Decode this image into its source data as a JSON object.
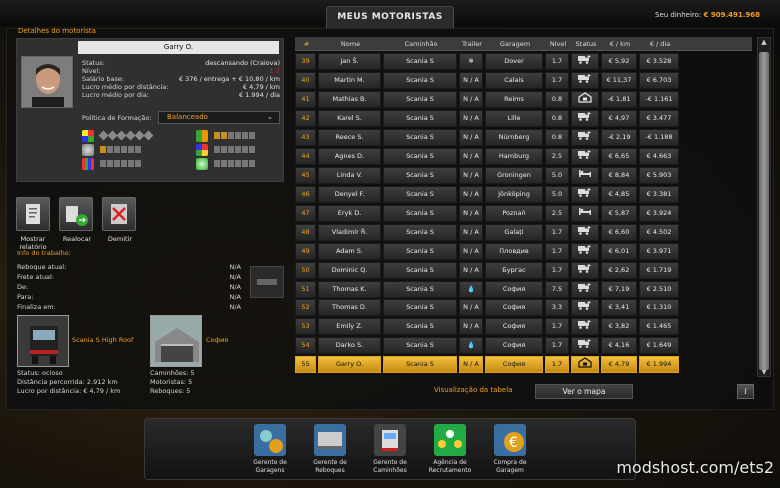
{
  "header": {
    "title": "MEUS MOTORISTAS",
    "money_label": "Seu dinheiro:",
    "money_value": "€ 909.491.968"
  },
  "details": {
    "title": "Detalhes do motorista",
    "name": "Garry O.",
    "stats": [
      {
        "label": "Status:",
        "value": "descansando (Craiova)",
        "red": false
      },
      {
        "label": "Nível:",
        "value": "1.7",
        "red": true
      },
      {
        "label": "Salário base:",
        "value": "€ 376 / entrega + € 10,80 / km",
        "red": false
      },
      {
        "label": "Lucro médio por distância:",
        "value": "€ 4,79 / km",
        "red": false
      },
      {
        "label": "Lucro médio por dia:",
        "value": "€ 1.994 / dia",
        "red": false
      }
    ],
    "policy_label": "Política de Formação:",
    "policy_value": "Balanceado",
    "skills_left": [
      {
        "icon": "adr-icon",
        "diamonds": 6,
        "squares": 0
      },
      {
        "icon": "distance-icon",
        "diamonds": 0,
        "squares": 6,
        "on": 0
      },
      {
        "icon": "valuable-cargo-icon",
        "diamonds": 0,
        "squares": 6,
        "on": 0
      }
    ],
    "skills_right": [
      {
        "icon": "high-value-icon",
        "squares": 6,
        "on": 0
      },
      {
        "icon": "fragile-icon",
        "squares": 6,
        "on": 0
      },
      {
        "icon": "eco-driving-icon",
        "squares": 6,
        "on": 0
      }
    ],
    "actions": [
      {
        "name": "show-report-button",
        "icon": "report-icon",
        "label": "Mostrar relatório"
      },
      {
        "name": "relocate-button",
        "icon": "relocate-icon",
        "label": "Realocar"
      },
      {
        "name": "fire-button",
        "icon": "fire-driver-icon",
        "label": "Demitir"
      }
    ]
  },
  "job": {
    "title": "Info do trabalho:",
    "rows": [
      {
        "label": "Reboque atual:",
        "value": "N/A"
      },
      {
        "label": "Frete atual:",
        "value": "N/A"
      },
      {
        "label": "De:",
        "value": "N/A"
      },
      {
        "label": "Para:",
        "value": "N/A"
      },
      {
        "label": "Finaliza em:",
        "value": "N/A"
      }
    ]
  },
  "truck": {
    "name": "Scania S High Roof",
    "status_label": "Status:",
    "status_value": "ocioso",
    "distance_label": "Distância percorrida:",
    "distance_value": "2.912 km",
    "profit_label": "Lucro por distância:",
    "profit_value": "€ 4,79 / km"
  },
  "garage": {
    "city": "София",
    "trucks_label": "Caminhões:",
    "trucks_value": "5",
    "drivers_label": "Motoristas:",
    "drivers_value": "5",
    "trailers_label": "Reboques:",
    "trailers_value": "5"
  },
  "table": {
    "headers": [
      "#",
      "Nome",
      "Caminhão",
      "Trailer",
      "Garagem",
      "Nível",
      "Status",
      "€ / km",
      "€ / dia"
    ],
    "rows": [
      {
        "n": "39",
        "name": "Jan Š.",
        "truck": "Scania S",
        "trailer": "❄",
        "garage": "Dover",
        "level": "1.7",
        "status": "driving",
        "km": "€ 5,92",
        "day": "€ 3.528"
      },
      {
        "n": "40",
        "name": "Martin M.",
        "truck": "Scania S",
        "trailer": "N / A",
        "garage": "Calais",
        "level": "1.7",
        "status": "driving",
        "km": "€ 11,37",
        "day": "€ 6.703"
      },
      {
        "n": "41",
        "name": "Mathias B.",
        "truck": "Scania S",
        "trailer": "N / A",
        "garage": "Reims",
        "level": "0.8",
        "status": "parked",
        "km": "-€ 1,81",
        "day": "-€ 1.161"
      },
      {
        "n": "42",
        "name": "Karel S.",
        "truck": "Scania S",
        "trailer": "N / A",
        "garage": "Lille",
        "level": "0.8",
        "status": "driving",
        "km": "€ 4,97",
        "day": "€ 3.477"
      },
      {
        "n": "43",
        "name": "Reece S.",
        "truck": "Scania S",
        "trailer": "N / A",
        "garage": "Nürnberg",
        "level": "0.8",
        "status": "driving",
        "km": "-€ 2,19",
        "day": "-€ 1.188"
      },
      {
        "n": "44",
        "name": "Agnes D.",
        "truck": "Scania S",
        "trailer": "N / A",
        "garage": "Hamburg",
        "level": "2.5",
        "status": "driving",
        "km": "€ 6,65",
        "day": "€ 4.663"
      },
      {
        "n": "45",
        "name": "Linda V.",
        "truck": "Scania S",
        "trailer": "N / A",
        "garage": "Groningen",
        "level": "5.0",
        "status": "resting",
        "km": "€ 8,84",
        "day": "€ 5.903"
      },
      {
        "n": "46",
        "name": "Denyel F.",
        "truck": "Scania S",
        "trailer": "N / A",
        "garage": "Jönköping",
        "level": "5.0",
        "status": "driving",
        "km": "€ 4,85",
        "day": "€ 3.381"
      },
      {
        "n": "47",
        "name": "Eryk D.",
        "truck": "Scania S",
        "trailer": "N / A",
        "garage": "Poznań",
        "level": "2.5",
        "status": "resting",
        "km": "€ 5,87",
        "day": "€ 3.924"
      },
      {
        "n": "48",
        "name": "Vladimír Ř.",
        "truck": "Scania S",
        "trailer": "N / A",
        "garage": "Galați",
        "level": "1.7",
        "status": "driving",
        "km": "€ 6,60",
        "day": "€ 4.502"
      },
      {
        "n": "49",
        "name": "Adam S.",
        "truck": "Scania S",
        "trailer": "N / A",
        "garage": "Пловдив",
        "level": "1.7",
        "status": "driving",
        "km": "€ 6,01",
        "day": "€ 3.971"
      },
      {
        "n": "50",
        "name": "Dominic Q.",
        "truck": "Scania S",
        "trailer": "N / A",
        "garage": "Бургас",
        "level": "1.7",
        "status": "driving",
        "km": "€ 2,62",
        "day": "€ 1.719"
      },
      {
        "n": "51",
        "name": "Thomas K.",
        "truck": "Scania S",
        "trailer": "💧",
        "garage": "София",
        "level": "7.5",
        "status": "driving",
        "km": "€ 7,19",
        "day": "€ 2.510"
      },
      {
        "n": "52",
        "name": "Thomas D.",
        "truck": "Scania S",
        "trailer": "N / A",
        "garage": "София",
        "level": "3.3",
        "status": "driving",
        "km": "€ 3,41",
        "day": "€ 1.310"
      },
      {
        "n": "53",
        "name": "Emily Z.",
        "truck": "Scania S",
        "trailer": "N / A",
        "garage": "София",
        "level": "1.7",
        "status": "driving",
        "km": "€ 3,82",
        "day": "€ 1.465"
      },
      {
        "n": "54",
        "name": "Darko S.",
        "truck": "Scania S",
        "trailer": "💧",
        "garage": "София",
        "level": "1.7",
        "status": "driving",
        "km": "€ 4,16",
        "day": "€ 1.649"
      },
      {
        "n": "55",
        "name": "Garry O.",
        "truck": "Scania S",
        "trailer": "N / A",
        "garage": "София",
        "level": "1.7",
        "status": "parked",
        "km": "€ 4,79",
        "day": "€ 1.994",
        "selected": true
      }
    ]
  },
  "footer": {
    "view_label": "Visualização da tabela",
    "map_button": "Ver o mapa",
    "info_button": "i"
  },
  "dock": [
    {
      "name": "dock-garage-manager",
      "icon": "garage-manager-icon",
      "label": "Gerente de Garagens"
    },
    {
      "name": "dock-trailer-manager",
      "icon": "trailer-manager-icon",
      "label": "Gerente de Reboques"
    },
    {
      "name": "dock-truck-manager",
      "icon": "truck-manager-icon",
      "label": "Gerente de Caminhões"
    },
    {
      "name": "dock-recruitment",
      "icon": "recruitment-agency-icon",
      "label": "Agência de Recrutamento"
    },
    {
      "name": "dock-purchase-garage",
      "icon": "purchase-garage-icon",
      "label": "Compra de Garagem"
    }
  ],
  "watermark": "modshost.com/ets2"
}
